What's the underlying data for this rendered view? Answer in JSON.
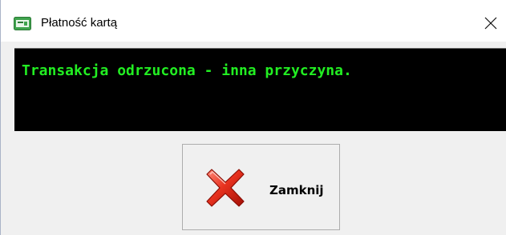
{
  "window": {
    "title": "Płatność kartą",
    "icon": "card-terminal-icon",
    "close_glyph": "✕"
  },
  "message": {
    "text": "Transakcja odrzucona - inna przyczyna.",
    "text_color": "#22ee22",
    "background": "#000000"
  },
  "button": {
    "label": "Zamknij",
    "icon": "red-x-icon"
  }
}
